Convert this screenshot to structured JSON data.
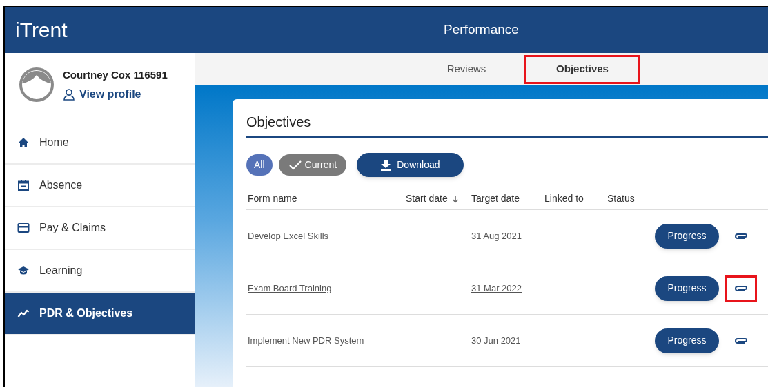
{
  "header": {
    "logo": "iTrent",
    "title": "Performance"
  },
  "user": {
    "name": "Courtney Cox 116591",
    "profile_link": "View profile"
  },
  "sidebar": {
    "items": [
      {
        "label": "Home",
        "selected": false
      },
      {
        "label": "Absence",
        "selected": false
      },
      {
        "label": "Pay & Claims",
        "selected": false
      },
      {
        "label": "Learning",
        "selected": false
      },
      {
        "label": "PDR & Objectives",
        "selected": true
      }
    ]
  },
  "tabs": [
    {
      "label": "Reviews",
      "selected": false,
      "highlighted": false
    },
    {
      "label": "Objectives",
      "selected": true,
      "highlighted": true
    }
  ],
  "card": {
    "title": "Objectives",
    "filters": [
      {
        "label": "All",
        "selected": true
      },
      {
        "label": "Current",
        "selected": false
      }
    ],
    "download_button": "Download",
    "table": {
      "columns": [
        {
          "label": "Form name",
          "sorted": false
        },
        {
          "label": "Start date",
          "sorted": true
        },
        {
          "label": "Target date",
          "sorted": false
        },
        {
          "label": "Linked to",
          "sorted": false
        },
        {
          "label": "Status",
          "sorted": false
        }
      ],
      "rows": [
        {
          "form_name": "Develop Excel Skills",
          "target_date": "31 Aug 2021",
          "linked": false,
          "button": "Progress",
          "attachment_highlighted": false
        },
        {
          "form_name": "Exam Board Training",
          "target_date": "31 Mar 2022",
          "linked": true,
          "button": "Progress",
          "attachment_highlighted": true
        },
        {
          "form_name": "Implement New PDR System",
          "target_date": "30 Jun 2021",
          "linked": false,
          "button": "Progress",
          "attachment_highlighted": false
        }
      ]
    }
  }
}
